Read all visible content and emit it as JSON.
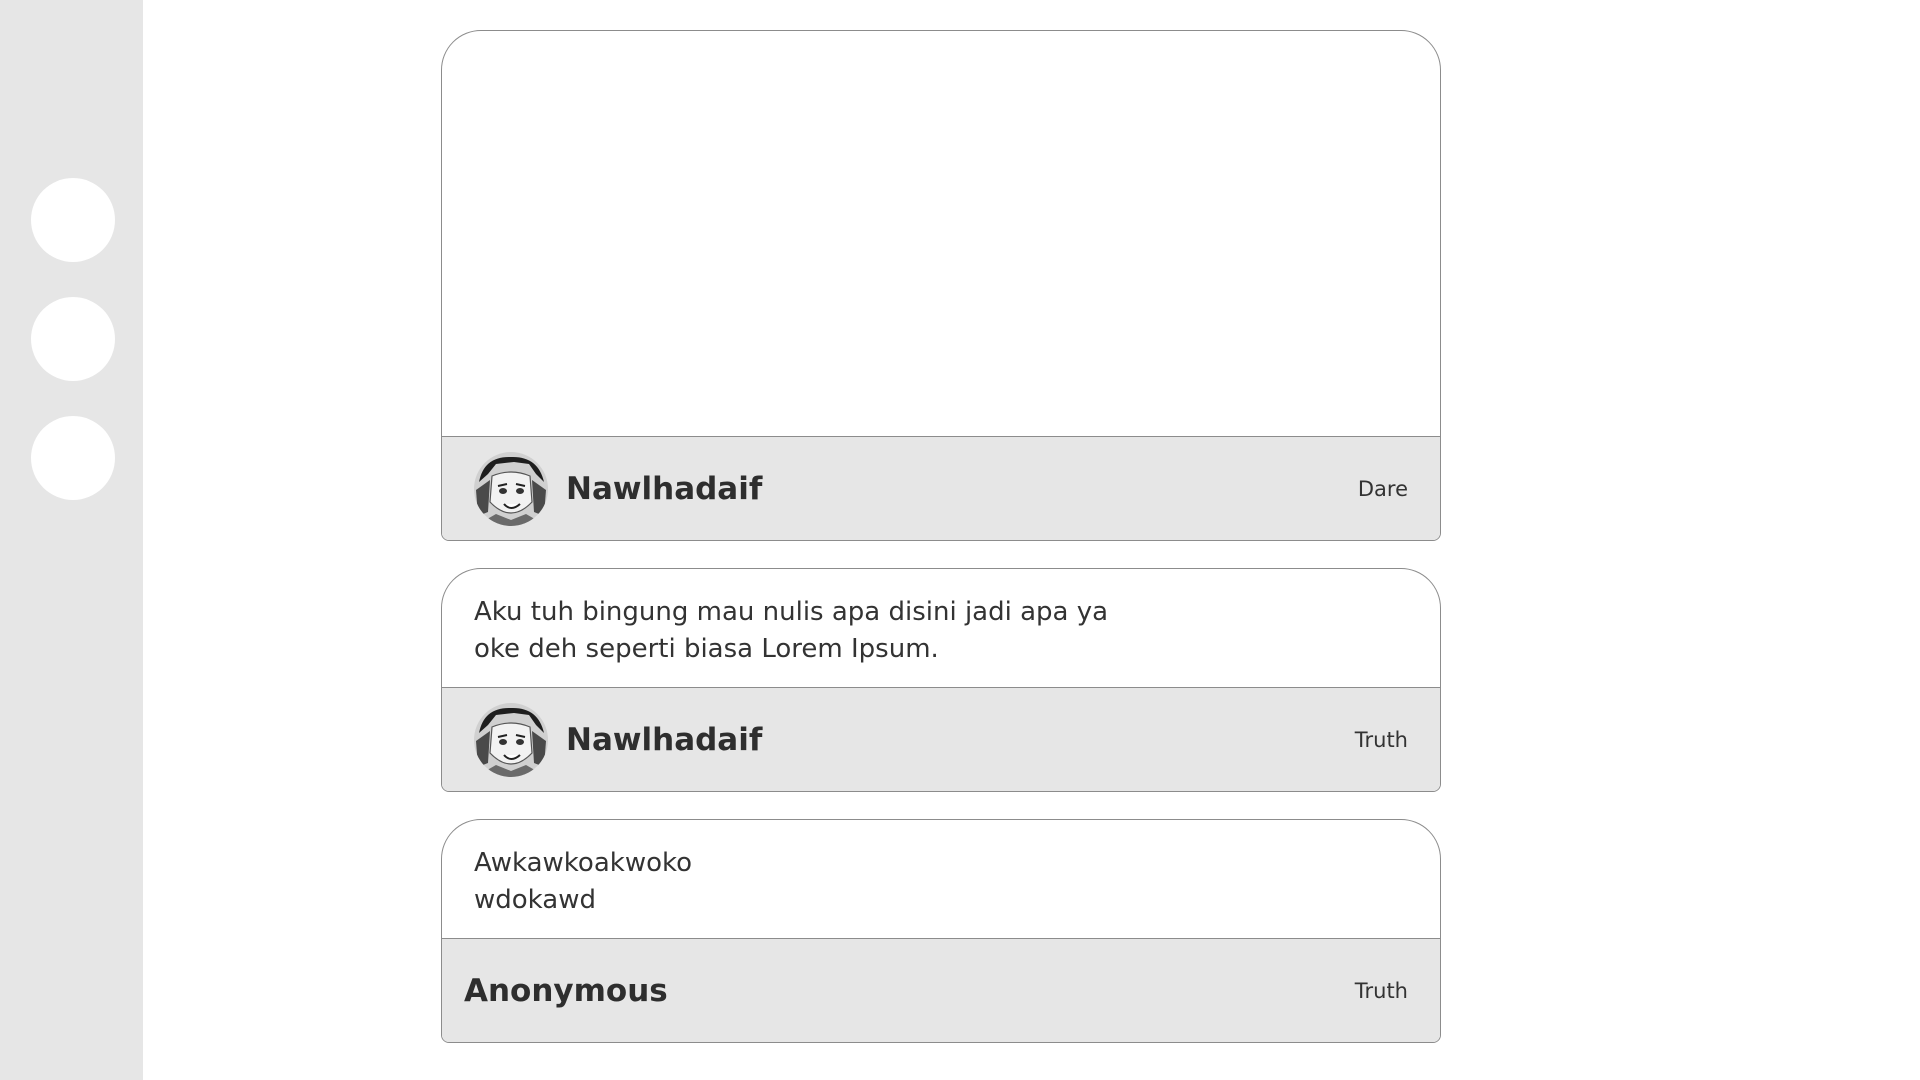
{
  "sidebar": {
    "buttons": [
      {
        "icon": "circle-button"
      },
      {
        "icon": "circle-button"
      },
      {
        "icon": "circle-button"
      }
    ]
  },
  "posts": [
    {
      "body_lines": [],
      "author": "Nawlhadaif",
      "avatar": "manga-character-avatar",
      "category": "Dare"
    },
    {
      "body_lines": [
        "Aku tuh bingung mau nulis apa disini jadi apa ya",
        "oke deh seperti biasa Lorem Ipsum."
      ],
      "author": "Nawlhadaif",
      "avatar": "manga-character-avatar",
      "category": "Truth"
    },
    {
      "body_lines": [
        "Awkawkoakwoko",
        "wdokawd"
      ],
      "author": "Anonymous",
      "avatar": null,
      "category": "Truth"
    }
  ]
}
